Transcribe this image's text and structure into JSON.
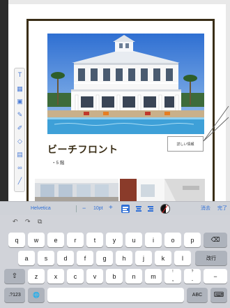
{
  "document": {
    "title": "ビーチフロント",
    "subtitle": "・5 階",
    "badge_text": "詳しい情報"
  },
  "vertical_toolbar": {
    "icons": [
      "text-icon",
      "table-icon",
      "image-icon",
      "pen-icon",
      "brush-icon",
      "shape-icon",
      "chart-icon",
      "link-icon",
      "line-icon"
    ]
  },
  "format_bar": {
    "font_name": "Helvetica",
    "minus": "−",
    "font_size": "10pt",
    "plus": "+",
    "done_label": "完了",
    "delete_label": "消去"
  },
  "keyboard": {
    "shortcuts": {
      "undo": "↶",
      "redo": "↷",
      "paste": "⧉"
    },
    "row1": [
      "q",
      "w",
      "e",
      "r",
      "t",
      "y",
      "u",
      "i",
      "o",
      "p"
    ],
    "delete": "⌫",
    "row2": [
      "a",
      "s",
      "d",
      "f",
      "g",
      "h",
      "j",
      "k",
      "l"
    ],
    "return": "改行",
    "shift": "⇧",
    "row3": [
      "z",
      "x",
      "c",
      "v",
      "b",
      "n",
      "m"
    ],
    "punct_1": "!",
    "punct_1_sub": ",",
    "punct_2": "?",
    "punct_2_sub": ".",
    "dash": "−",
    "numbers": ".?123",
    "globe": "🌐",
    "abc": "ABC",
    "dismiss": "⌨"
  }
}
